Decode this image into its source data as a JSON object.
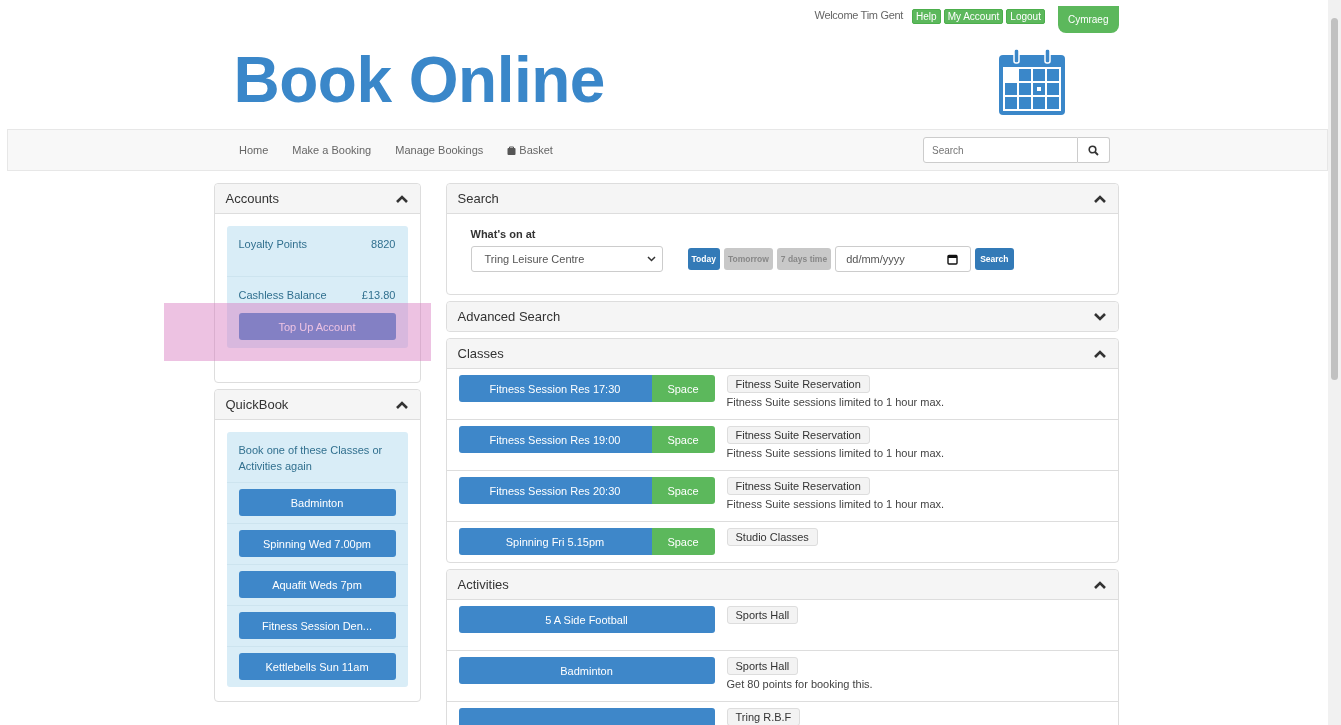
{
  "top_bar": {
    "welcome": "Welcome Tim Gent",
    "links": [
      "Help",
      "My Account",
      "Logout"
    ],
    "language": "Cymraeg"
  },
  "header": {
    "title": "Book Online"
  },
  "nav": {
    "items": [
      {
        "label": "Home",
        "kind": "text"
      },
      {
        "label": "Make a Booking",
        "kind": "text"
      },
      {
        "label": "Manage Bookings",
        "kind": "text"
      },
      {
        "label": "Basket",
        "kind": "basket"
      }
    ],
    "search": {
      "placeholder": "Search"
    }
  },
  "accounts": {
    "title": "Accounts",
    "expanded": true,
    "rows": [
      {
        "label": "Loyalty Points",
        "value": "8820"
      },
      {
        "label": "Cashless Balance",
        "value": "£13.80"
      }
    ],
    "top_up": {
      "label": "Top Up Account",
      "highlighted": true
    }
  },
  "quickbook": {
    "title": "QuickBook",
    "expanded": true,
    "intro": "Book one of these Classes or Activities again",
    "items": [
      "Badminton",
      "Spinning Wed 7.00pm",
      "Aquafit Weds 7pm",
      "Fitness Session Den...",
      "Kettlebells Sun 11am"
    ]
  },
  "search_panel": {
    "title": "Search",
    "expanded": true,
    "label": "What's on at",
    "venue": "Tring Leisure Centre",
    "date_buttons": [
      {
        "label": "Today",
        "selected": true
      },
      {
        "label": "Tomorrow",
        "selected": false
      },
      {
        "label": "7 days time",
        "selected": false
      }
    ],
    "date": {
      "placeholder": "dd/mm/yyyy"
    },
    "submit": "Search"
  },
  "advanced_search": {
    "title": "Advanced Search",
    "expanded": false
  },
  "classes": {
    "title": "Classes",
    "expanded": true,
    "rows": [
      {
        "name": "Fitness Session Res 17:30",
        "availability": "Space",
        "location": "Fitness Suite Reservation",
        "note": "Fitness Suite sessions limited to 1 hour max."
      },
      {
        "name": "Fitness Session Res 19:00",
        "availability": "Space",
        "location": "Fitness Suite Reservation",
        "note": "Fitness Suite sessions limited to 1 hour max."
      },
      {
        "name": "Fitness Session Res 20:30",
        "availability": "Space",
        "location": "Fitness Suite Reservation",
        "note": "Fitness Suite sessions limited to 1 hour max."
      },
      {
        "name": "Spinning Fri 5.15pm",
        "availability": "Space",
        "location": "Studio Classes"
      }
    ]
  },
  "activities": {
    "title": "Activities",
    "expanded": true,
    "rows": [
      {
        "name": "5 A Side Football",
        "location": "Sports Hall"
      },
      {
        "name": "Badminton",
        "location": "Sports Hall",
        "note": "Get 80 points for booking this."
      },
      {
        "location": "Tring R.B.F"
      }
    ]
  }
}
